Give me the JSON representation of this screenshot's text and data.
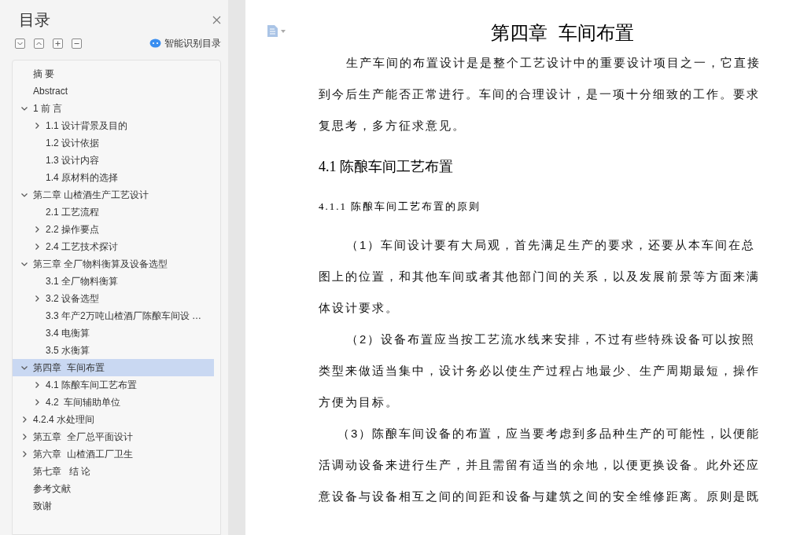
{
  "sidebar": {
    "title": "目录",
    "smart_toc": {
      "label": "智能识别目录"
    },
    "tree": [
      {
        "label": "摘 要",
        "kind": "leaf",
        "selected": false
      },
      {
        "label": "Abstract",
        "kind": "leaf",
        "selected": false
      },
      {
        "label": "1 前 言",
        "kind": "branch",
        "expanded": true,
        "selected": false,
        "children": [
          {
            "label": "1.1 设计背景及目的",
            "kind": "branch",
            "expanded": false,
            "selected": false
          },
          {
            "label": "1.2 设计依据",
            "kind": "leaf",
            "selected": false
          },
          {
            "label": "1.3 设计内容",
            "kind": "leaf",
            "selected": false
          },
          {
            "label": "1.4 原材料的选择",
            "kind": "leaf",
            "selected": false
          }
        ]
      },
      {
        "label": "第二章 山楂酒生产工艺设计",
        "kind": "branch",
        "expanded": true,
        "selected": false,
        "children": [
          {
            "label": "2.1 工艺流程",
            "kind": "leaf",
            "selected": false
          },
          {
            "label": "2.2 操作要点",
            "kind": "branch",
            "expanded": false,
            "selected": false
          },
          {
            "label": "2.4 工艺技术探讨",
            "kind": "branch",
            "expanded": false,
            "selected": false
          }
        ]
      },
      {
        "label": "第三章 全厂物料衡算及设备选型",
        "kind": "branch",
        "expanded": true,
        "selected": false,
        "children": [
          {
            "label": "3.1 全厂物料衡算",
            "kind": "leaf",
            "selected": false
          },
          {
            "label": "3.2 设备选型",
            "kind": "branch",
            "expanded": false,
            "selected": false
          },
          {
            "label": "3.3 年产2万吨山楂酒厂陈酿车间设 …",
            "kind": "leaf",
            "selected": false
          },
          {
            "label": "3.4 电衡算",
            "kind": "leaf",
            "selected": false
          },
          {
            "label": "3.5 水衡算",
            "kind": "leaf",
            "selected": false
          }
        ]
      },
      {
        "label": "第四章  车间布置",
        "kind": "branch",
        "expanded": true,
        "selected": true,
        "children": [
          {
            "label": "4.1 陈酿车间工艺布置",
            "kind": "branch",
            "expanded": false,
            "selected": false
          },
          {
            "label": "4.2  车间辅助单位",
            "kind": "branch",
            "expanded": false,
            "selected": false
          }
        ]
      },
      {
        "label": "4.2.4 水处理间",
        "kind": "branch",
        "expanded": false,
        "selected": false
      },
      {
        "label": "第五章  全厂总平面设计",
        "kind": "branch",
        "expanded": false,
        "selected": false
      },
      {
        "label": "第六章  山楂酒工厂卫生",
        "kind": "branch",
        "expanded": false,
        "selected": false
      },
      {
        "label": "第七章   结 论",
        "kind": "leaf",
        "selected": false
      },
      {
        "label": "参考文献",
        "kind": "leaf",
        "selected": false
      },
      {
        "label": "致谢",
        "kind": "leaf",
        "selected": false
      }
    ]
  },
  "document": {
    "chapter_title": "第四章  车间布置",
    "blocks": [
      {
        "kind": "paragraph",
        "lines": [
          "生产车间的布置设计是是整个工艺设计中的重要设计项目之一，它直接",
          "到今后生产能否正常进行。车间的合理设计，是一项十分细致的工作。要求",
          "复思考，多方征求意见。"
        ]
      },
      {
        "kind": "heading",
        "text": "4.1 陈酿车间工艺布置"
      },
      {
        "kind": "subheading",
        "text": "4.1.1 陈酿车间工艺布置的原则"
      },
      {
        "kind": "paragraph",
        "lines": [
          "（1）车间设计要有大局观，首先满足生产的要求，还要从本车间在总",
          "图上的位置，和其他车间或者其他部门间的关系，以及发展前景等方面来满",
          "体设计要求。"
        ]
      },
      {
        "kind": "paragraph",
        "lines": [
          "（2）设备布置应当按工艺流水线来安排，不过有些特殊设备可以按照",
          "类型来做适当集中，设计务必以使生产过程占地最少、生产周期最短，操作",
          "方便为目标。"
        ]
      },
      {
        "kind": "paragraph_short_indent",
        "lines": [
          "（3）陈酿车间设备的布置，应当要考虑到多品种生产的可能性，以便能",
          "活调动设备来进行生产，并且需留有适当的余地，以便更换设备。此外还应",
          "意设备与设备相互之间的间距和设备与建筑之间的安全维修距离。原则是既"
        ]
      }
    ]
  }
}
